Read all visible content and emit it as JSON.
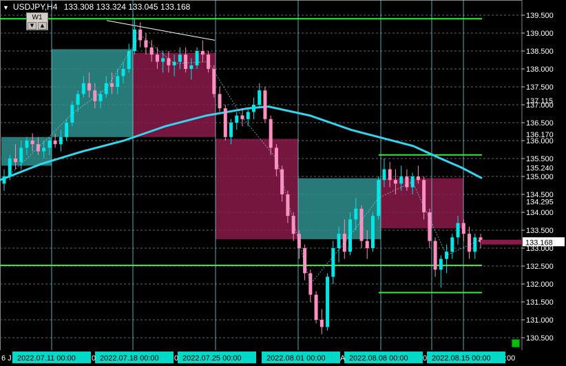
{
  "header": {
    "symbol": "USDJPY,H4",
    "open": "133.308",
    "high": "133.324",
    "low": "133.045",
    "close": "133.168"
  },
  "timeframe_button": {
    "label": "W1",
    "down_arrow": "triangle-down-icon",
    "up_arrow": "triangle-up-icon"
  },
  "price_axis": {
    "labels": [
      "139.500",
      "139.000",
      "138.500",
      "138.000",
      "137.500",
      "137.000",
      "136.500",
      "136.000",
      "135.500",
      "135.000",
      "134.500",
      "134.000",
      "133.500",
      "133.000",
      "132.500",
      "132.000",
      "131.500",
      "131.000",
      "130.500"
    ],
    "extra_labels": [
      "137.115",
      "136.170",
      "135.240",
      "134.295"
    ],
    "current_price": "133.168"
  },
  "time_axis": {
    "edge_left": "6 J",
    "labels": [
      "2022.07.11 00:00",
      "2022.07.18 00:00",
      "2022.07.25 00:00",
      "2022.08.01 00:00",
      "2022.08.08 00:00",
      "2022.08.15 00:00"
    ],
    "separators": [
      "0",
      "0",
      "A",
      "0"
    ],
    "edge_right": ":00"
  },
  "colors": {
    "background": "#000000",
    "bull_candle": "#00e5e5",
    "bear_candle": "#ff8fc0",
    "weekly_bull_box": "#2e8f8c",
    "weekly_bear_box": "#8a1a4a",
    "moving_average": "#33d6ee",
    "green_levels": "#33ee33",
    "grid": "#666666",
    "vertical_lines": "#7fdfe8",
    "time_label_bg": "#00d8c8"
  },
  "chart_data": {
    "type": "candlestick",
    "symbol": "USDJPY",
    "timeframe": "H4",
    "ylim": [
      130.3,
      139.8
    ],
    "grid": true,
    "weekly_boxes": [
      {
        "week": "2022.07.04",
        "open": 135.3,
        "close": 136.1,
        "direction": "up"
      },
      {
        "week": "2022.07.11",
        "open": 136.1,
        "close": 138.55,
        "direction": "up"
      },
      {
        "week": "2022.07.18",
        "open": 138.45,
        "close": 136.1,
        "direction": "down"
      },
      {
        "week": "2022.07.25",
        "open": 136.05,
        "close": 133.25,
        "direction": "down"
      },
      {
        "week": "2022.08.01",
        "open": 133.25,
        "close": 134.95,
        "direction": "up"
      },
      {
        "week": "2022.08.08",
        "open": 134.95,
        "close": 133.55,
        "direction": "down"
      }
    ],
    "horizontal_levels": [
      139.4,
      135.6,
      132.52,
      131.76
    ],
    "moving_average": [
      [
        0,
        134.9
      ],
      [
        60,
        135.35
      ],
      [
        120,
        135.7
      ],
      [
        180,
        136.0
      ],
      [
        240,
        136.4
      ],
      [
        300,
        136.7
      ],
      [
        360,
        136.9
      ],
      [
        390,
        136.95
      ],
      [
        450,
        136.7
      ],
      [
        510,
        136.3
      ],
      [
        560,
        136.05
      ],
      [
        600,
        135.85
      ],
      [
        640,
        135.5
      ],
      [
        670,
        135.25
      ],
      [
        700,
        134.95
      ]
    ],
    "trendline": [
      [
        155,
        139.35
      ],
      [
        312,
        138.8
      ]
    ],
    "candles": [
      [
        134.8,
        135.2,
        134.6,
        135.0
      ],
      [
        135.0,
        135.6,
        134.9,
        135.5
      ],
      [
        135.5,
        135.9,
        135.2,
        135.4
      ],
      [
        135.4,
        136.0,
        135.2,
        135.8
      ],
      [
        135.8,
        136.1,
        135.6,
        136.0
      ],
      [
        136.0,
        136.2,
        135.7,
        135.9
      ],
      [
        135.9,
        136.1,
        135.6,
        135.7
      ],
      [
        135.7,
        136.0,
        135.5,
        135.8
      ],
      [
        135.8,
        136.1,
        135.6,
        136.0
      ],
      [
        136.0,
        136.2,
        135.8,
        135.9
      ],
      [
        135.9,
        136.3,
        135.7,
        136.1
      ],
      [
        136.1,
        136.6,
        136.0,
        136.5
      ],
      [
        136.5,
        137.1,
        136.4,
        137.0
      ],
      [
        137.0,
        137.4,
        136.8,
        137.3
      ],
      [
        137.3,
        137.8,
        137.2,
        137.6
      ],
      [
        137.6,
        137.9,
        137.2,
        137.4
      ],
      [
        137.4,
        137.6,
        136.9,
        137.1
      ],
      [
        137.1,
        137.4,
        136.9,
        137.3
      ],
      [
        137.3,
        137.8,
        137.2,
        137.6
      ],
      [
        137.6,
        137.9,
        137.3,
        137.5
      ],
      [
        137.5,
        138.0,
        137.3,
        137.8
      ],
      [
        137.8,
        138.2,
        137.6,
        138.0
      ],
      [
        138.0,
        138.7,
        137.9,
        138.5
      ],
      [
        138.5,
        139.4,
        138.4,
        139.1
      ],
      [
        139.1,
        139.3,
        138.6,
        138.8
      ],
      [
        138.8,
        139.0,
        138.4,
        138.6
      ],
      [
        138.6,
        138.8,
        138.2,
        138.4
      ],
      [
        138.4,
        138.6,
        138.0,
        138.2
      ],
      [
        138.2,
        138.5,
        137.9,
        138.3
      ],
      [
        138.3,
        138.5,
        137.9,
        138.1
      ],
      [
        138.1,
        138.4,
        137.8,
        138.2
      ],
      [
        138.2,
        138.6,
        138.0,
        138.4
      ],
      [
        138.4,
        138.6,
        137.9,
        138.0
      ],
      [
        138.0,
        138.3,
        137.7,
        138.1
      ],
      [
        138.1,
        138.6,
        138.0,
        138.5
      ],
      [
        138.5,
        138.8,
        138.2,
        138.4
      ],
      [
        138.4,
        138.5,
        137.9,
        138.0
      ],
      [
        138.0,
        138.1,
        137.2,
        137.3
      ],
      [
        137.3,
        137.5,
        136.8,
        136.9
      ],
      [
        136.9,
        137.0,
        136.0,
        136.1
      ],
      [
        136.1,
        136.6,
        135.9,
        136.5
      ],
      [
        136.5,
        136.8,
        136.3,
        136.7
      ],
      [
        136.7,
        136.9,
        136.4,
        136.6
      ],
      [
        136.6,
        136.9,
        136.4,
        136.8
      ],
      [
        136.8,
        137.2,
        136.6,
        137.0
      ],
      [
        137.0,
        137.6,
        136.9,
        137.4
      ],
      [
        137.4,
        137.5,
        136.5,
        136.6
      ],
      [
        136.6,
        136.7,
        135.6,
        135.8
      ],
      [
        135.8,
        135.9,
        135.0,
        135.2
      ],
      [
        135.2,
        135.3,
        134.3,
        134.5
      ],
      [
        134.5,
        134.6,
        133.7,
        133.9
      ],
      [
        133.9,
        134.0,
        133.2,
        133.4
      ],
      [
        133.4,
        133.5,
        132.7,
        133.0
      ],
      [
        133.0,
        133.1,
        132.1,
        132.3
      ],
      [
        132.3,
        132.4,
        131.5,
        131.7
      ],
      [
        131.7,
        131.8,
        130.9,
        131.0
      ],
      [
        131.0,
        131.3,
        130.6,
        130.8
      ],
      [
        130.8,
        132.3,
        130.7,
        132.2
      ],
      [
        132.2,
        133.2,
        132.0,
        133.0
      ],
      [
        133.0,
        133.6,
        132.6,
        133.4
      ],
      [
        133.4,
        133.8,
        132.7,
        132.9
      ],
      [
        132.9,
        134.0,
        132.8,
        133.8
      ],
      [
        133.8,
        134.4,
        133.5,
        134.1
      ],
      [
        134.1,
        134.2,
        133.0,
        133.2
      ],
      [
        133.2,
        133.5,
        132.7,
        133.0
      ],
      [
        133.0,
        134.0,
        132.9,
        133.9
      ],
      [
        133.9,
        135.0,
        133.8,
        134.9
      ],
      [
        134.9,
        135.5,
        134.7,
        135.2
      ],
      [
        135.2,
        135.4,
        134.7,
        134.9
      ],
      [
        134.9,
        135.2,
        134.5,
        134.8
      ],
      [
        134.8,
        135.3,
        134.6,
        135.0
      ],
      [
        135.0,
        135.2,
        134.6,
        134.7
      ],
      [
        134.7,
        135.1,
        134.5,
        135.0
      ],
      [
        135.0,
        135.3,
        134.8,
        134.9
      ],
      [
        134.9,
        135.0,
        133.8,
        134.0
      ],
      [
        134.0,
        134.1,
        133.0,
        133.2
      ],
      [
        133.2,
        133.3,
        132.2,
        132.4
      ],
      [
        132.4,
        132.8,
        131.9,
        132.7
      ],
      [
        132.7,
        133.1,
        132.3,
        132.9
      ],
      [
        132.9,
        133.4,
        132.7,
        133.3
      ],
      [
        133.3,
        133.9,
        133.1,
        133.7
      ],
      [
        133.7,
        133.8,
        133.2,
        133.4
      ],
      [
        133.4,
        133.6,
        132.7,
        132.9
      ],
      [
        132.9,
        133.4,
        132.7,
        133.3
      ],
      [
        133.3,
        133.4,
        133.0,
        133.17
      ]
    ]
  }
}
